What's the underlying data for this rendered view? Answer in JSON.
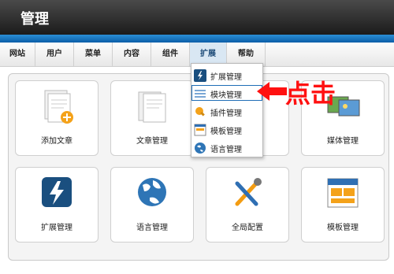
{
  "app": {
    "title": "管理"
  },
  "nav": {
    "tabs": [
      "网站",
      "用户",
      "菜单",
      "内容",
      "组件",
      "扩展",
      "帮助"
    ],
    "active_tab": "扩展"
  },
  "dropdown": {
    "items": [
      "扩展管理",
      "模块管理",
      "插件管理",
      "模板管理",
      "语言管理"
    ],
    "selected": "模块管理"
  },
  "annotation": {
    "text": "点击",
    "color": "#ff1111"
  },
  "cards": [
    "添加文章",
    "文章管理",
    "",
    "媒体管理",
    "扩展管理",
    "语言管理",
    "全局配置",
    "模板管理"
  ],
  "colors": {
    "header_dark": "#1b1b1b",
    "header_blue": "#0b5ea8",
    "highlight_border": "#1f6db6",
    "arrow_red": "#ff1111"
  }
}
